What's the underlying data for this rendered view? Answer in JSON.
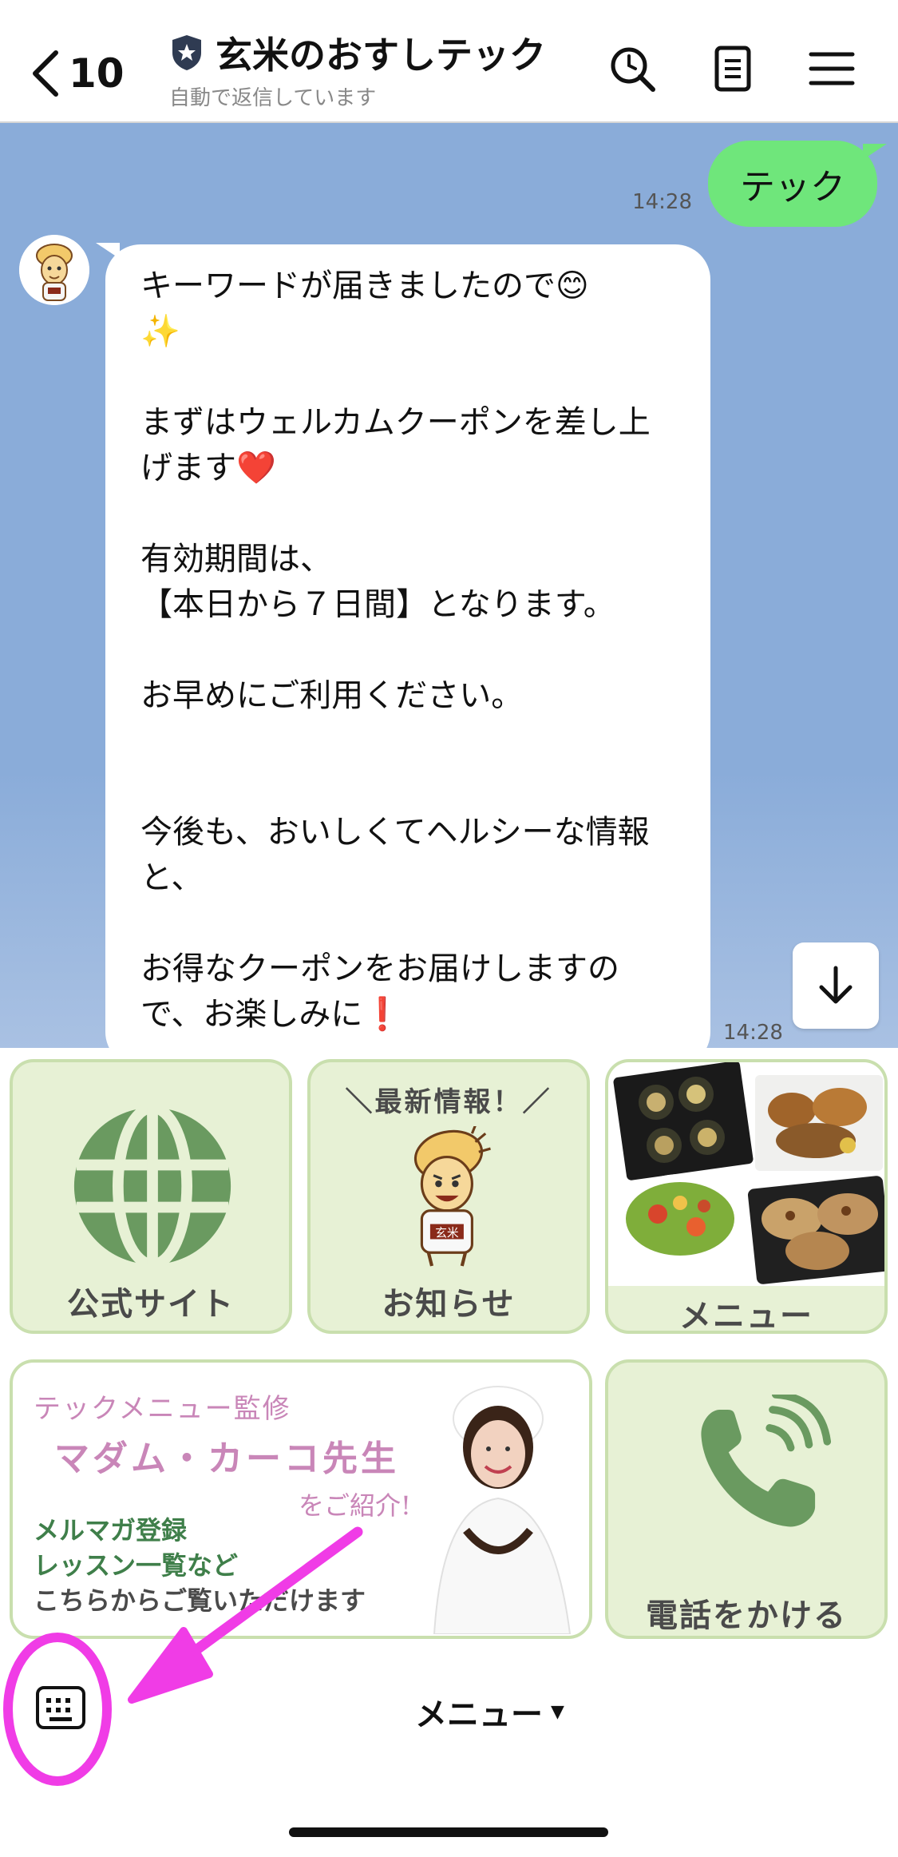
{
  "header": {
    "back_count": "10",
    "title": "玄米のおすしテック",
    "subtitle": "自動で返信しています",
    "icons": [
      "chevron-left-icon",
      "shield-star-icon",
      "search-icon",
      "notes-icon",
      "menu-icon"
    ]
  },
  "chat": {
    "sent_message": "テック",
    "sent_time": "14:28",
    "received_message": "キーワードが届きましたので😊\n✨\n\nまずはウェルカムクーポンを差し上げます❤️\n\n有効期間は、\n【本日から７日間】となります。\n\nお早めにご利用ください。\n\n\n今後も、おいしくてヘルシーな情報と、\n\nお得なクーポンをお届けしますので、お楽しみに❗️",
    "received_time": "14:28"
  },
  "richmenu": {
    "official_site": "公式サイト",
    "news_heading": "＼最新情報！／",
    "news": "お知らせ",
    "menu": "メニュー",
    "banner_line1": "テックメニュー監修",
    "banner_name": "マダム・カーコ先生",
    "banner_intro": "をご紹介!",
    "banner_text1": "メルマガ登録",
    "banner_text2": "レッスン一覧など",
    "banner_text3": "こちらからご覧いただけます",
    "call": "電話をかける",
    "mascot_badge": "玄米"
  },
  "bottom": {
    "menu_toggle": "メニュー",
    "caret": "▼"
  },
  "colors": {
    "chat_bg": "#8aacd9",
    "sent_bubble": "#6fe67b",
    "tile_bg": "#e7f1d5",
    "tile_border": "#c9dfae",
    "globe_green": "#6a9a60",
    "annotation_magenta": "#f03ce6",
    "banner_pink": "#c986b8",
    "banner_green": "#3f7f4a"
  }
}
